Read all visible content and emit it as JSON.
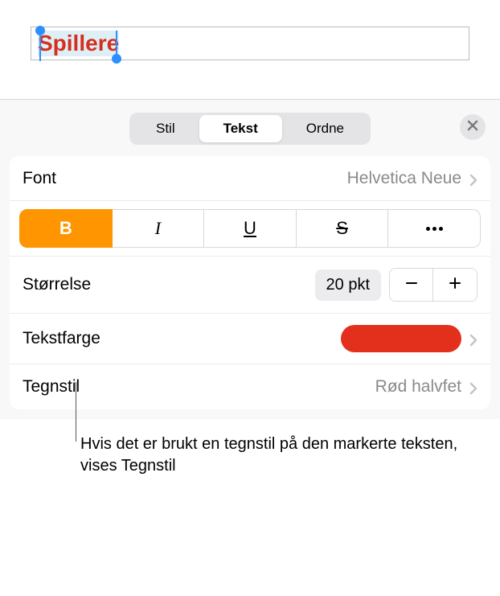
{
  "editor": {
    "selected_text": "Spillere"
  },
  "tabs": {
    "items": [
      "Stil",
      "Tekst",
      "Ordne"
    ],
    "active_index": 1
  },
  "font_row": {
    "label": "Font",
    "value": "Helvetica Neue"
  },
  "style_buttons": {
    "bold": "B",
    "italic": "I",
    "underline": "U",
    "strike": "S"
  },
  "size_row": {
    "label": "Størrelse",
    "value": "20 pkt"
  },
  "color_row": {
    "label": "Tekstfarge",
    "swatch_color": "#e3301c"
  },
  "charstyle_row": {
    "label": "Tegnstil",
    "value": "Rød halvfet"
  },
  "caption": "Hvis det er brukt en tegnstil på den markerte teksten, vises Tegnstil"
}
